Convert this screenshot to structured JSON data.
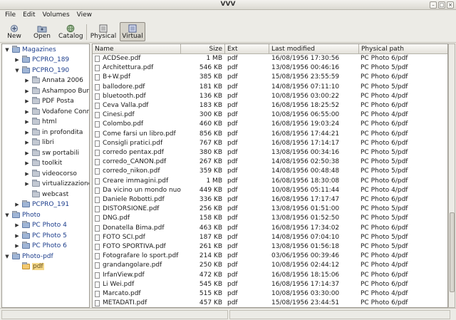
{
  "window": {
    "title": "VVV"
  },
  "menu": [
    "File",
    "Edit",
    "Volumes",
    "View"
  ],
  "toolbar": {
    "new": "New",
    "open": "Open",
    "catalog": "Catalog",
    "physical": "Physical",
    "virtual": "Virtual"
  },
  "tree": [
    {
      "label": "Magazines",
      "level": 0,
      "exp": "▼",
      "color": "blue"
    },
    {
      "label": "PCPRO_189",
      "level": 1,
      "exp": "▶",
      "color": "blue"
    },
    {
      "label": "PCPRO_190",
      "level": 1,
      "exp": "▼",
      "color": "blue"
    },
    {
      "label": "Annata 2006",
      "level": 2,
      "exp": "▶",
      "color": "gray"
    },
    {
      "label": "Ashampoo Burning",
      "level": 2,
      "exp": "▶",
      "color": "gray"
    },
    {
      "label": "PDF Posta",
      "level": 2,
      "exp": "▶",
      "color": "gray"
    },
    {
      "label": "Vodafone Connect",
      "level": 2,
      "exp": "▶",
      "color": "gray"
    },
    {
      "label": "html",
      "level": 2,
      "exp": "▶",
      "color": "gray"
    },
    {
      "label": "in profondita",
      "level": 2,
      "exp": "▶",
      "color": "gray"
    },
    {
      "label": "libri",
      "level": 2,
      "exp": "▶",
      "color": "gray"
    },
    {
      "label": "sw portabili",
      "level": 2,
      "exp": "▶",
      "color": "gray"
    },
    {
      "label": "toolkit",
      "level": 2,
      "exp": "▶",
      "color": "gray"
    },
    {
      "label": "videocorso",
      "level": 2,
      "exp": "▶",
      "color": "gray"
    },
    {
      "label": "virtualizzazione",
      "level": 2,
      "exp": "▶",
      "color": "gray"
    },
    {
      "label": "webcast",
      "level": 2,
      "exp": "",
      "color": "gray"
    },
    {
      "label": "PCPRO_191",
      "level": 1,
      "exp": "▶",
      "color": "blue"
    },
    {
      "label": "Photo",
      "level": 0,
      "exp": "▼",
      "color": "blue"
    },
    {
      "label": "PC Photo 4",
      "level": 1,
      "exp": "▶",
      "color": "blue"
    },
    {
      "label": "PC Photo 5",
      "level": 1,
      "exp": "▶",
      "color": "blue"
    },
    {
      "label": "PC Photo 6",
      "level": 1,
      "exp": "▶",
      "color": "blue"
    },
    {
      "label": "Photo-pdf",
      "level": 0,
      "exp": "▼",
      "color": "blue"
    },
    {
      "label": "pdf",
      "level": 1,
      "exp": "",
      "color": "selected"
    }
  ],
  "columns": {
    "name": "Name",
    "size": "Size",
    "ext": "Ext",
    "modified": "Last modified",
    "physical": "Physical path"
  },
  "files": [
    {
      "name": "ACDSee.pdf",
      "size": "1 MB",
      "ext": "pdf",
      "modified": "16/08/1956 17:30:56",
      "physical": "PC Photo 6/pdf"
    },
    {
      "name": "Architettura.pdf",
      "size": "546 KB",
      "ext": "pdf",
      "modified": "13/08/1956 00:46:16",
      "physical": "PC Photo 5/pdf"
    },
    {
      "name": "B+W.pdf",
      "size": "385 KB",
      "ext": "pdf",
      "modified": "15/08/1956 23:55:59",
      "physical": "PC Photo 6/pdf"
    },
    {
      "name": "ballodore.pdf",
      "size": "181 KB",
      "ext": "pdf",
      "modified": "14/08/1956 07:11:10",
      "physical": "PC Photo 5/pdf"
    },
    {
      "name": "bluetooth.pdf",
      "size": "136 KB",
      "ext": "pdf",
      "modified": "10/08/1956 03:00:22",
      "physical": "PC Photo 4/pdf"
    },
    {
      "name": "Ceva Valla.pdf",
      "size": "183 KB",
      "ext": "pdf",
      "modified": "16/08/1956 18:25:52",
      "physical": "PC Photo 6/pdf"
    },
    {
      "name": "Cinesi.pdf",
      "size": "300 KB",
      "ext": "pdf",
      "modified": "10/08/1956 06:55:00",
      "physical": "PC Photo 4/pdf"
    },
    {
      "name": "Colombo.pdf",
      "size": "460 KB",
      "ext": "pdf",
      "modified": "16/08/1956 19:03:24",
      "physical": "PC Photo 6/pdf"
    },
    {
      "name": "Come farsi un libro.pdf",
      "size": "856 KB",
      "ext": "pdf",
      "modified": "16/08/1956 17:44:21",
      "physical": "PC Photo 6/pdf"
    },
    {
      "name": "Consigli pratici.pdf",
      "size": "767 KB",
      "ext": "pdf",
      "modified": "16/08/1956 17:14:17",
      "physical": "PC Photo 6/pdf"
    },
    {
      "name": "corredo pentax.pdf",
      "size": "380 KB",
      "ext": "pdf",
      "modified": "13/08/1956 00:34:16",
      "physical": "PC Photo 5/pdf"
    },
    {
      "name": "corredo_CANON.pdf",
      "size": "267 KB",
      "ext": "pdf",
      "modified": "14/08/1956 02:50:38",
      "physical": "PC Photo 5/pdf"
    },
    {
      "name": "corredo_nikon.pdf",
      "size": "359 KB",
      "ext": "pdf",
      "modified": "14/08/1956 00:48:48",
      "physical": "PC Photo 5/pdf"
    },
    {
      "name": "Creare immagini.pdf",
      "size": "1 MB",
      "ext": "pdf",
      "modified": "16/08/1956 18:30:08",
      "physical": "PC Photo 6/pdf"
    },
    {
      "name": "Da vicino un mondo nuo...",
      "size": "449 KB",
      "ext": "pdf",
      "modified": "10/08/1956 05:11:44",
      "physical": "PC Photo 4/pdf"
    },
    {
      "name": "Daniele Robotti.pdf",
      "size": "336 KB",
      "ext": "pdf",
      "modified": "16/08/1956 17:17:47",
      "physical": "PC Photo 6/pdf"
    },
    {
      "name": "DISTORSIONE.pdf",
      "size": "256 KB",
      "ext": "pdf",
      "modified": "13/08/1956 01:51:00",
      "physical": "PC Photo 5/pdf"
    },
    {
      "name": "DNG.pdf",
      "size": "158 KB",
      "ext": "pdf",
      "modified": "13/08/1956 01:52:50",
      "physical": "PC Photo 5/pdf"
    },
    {
      "name": "Donatella Bima.pdf",
      "size": "463 KB",
      "ext": "pdf",
      "modified": "16/08/1956 17:34:02",
      "physical": "PC Photo 6/pdf"
    },
    {
      "name": "FOTO SCI.pdf",
      "size": "187 KB",
      "ext": "pdf",
      "modified": "14/08/1956 07:04:10",
      "physical": "PC Photo 5/pdf"
    },
    {
      "name": "FOTO SPORTIVA.pdf",
      "size": "261 KB",
      "ext": "pdf",
      "modified": "13/08/1956 01:56:18",
      "physical": "PC Photo 5/pdf"
    },
    {
      "name": "Fotografare lo sport.pdf",
      "size": "214 KB",
      "ext": "pdf",
      "modified": "03/06/1956 00:39:46",
      "physical": "PC Photo 4/pdf"
    },
    {
      "name": "grandangolare.pdf",
      "size": "250 KB",
      "ext": "pdf",
      "modified": "10/08/1956 02:44:12",
      "physical": "PC Photo 4/pdf"
    },
    {
      "name": "IrfanView.pdf",
      "size": "472 KB",
      "ext": "pdf",
      "modified": "16/08/1956 18:15:06",
      "physical": "PC Photo 6/pdf"
    },
    {
      "name": "Li Wei.pdf",
      "size": "545 KB",
      "ext": "pdf",
      "modified": "16/08/1956 17:14:37",
      "physical": "PC Photo 6/pdf"
    },
    {
      "name": "Marcato.pdf",
      "size": "515 KB",
      "ext": "pdf",
      "modified": "10/08/1956 03:30:00",
      "physical": "PC Photo 4/pdf"
    },
    {
      "name": "METADATI.pdf",
      "size": "457 KB",
      "ext": "pdf",
      "modified": "15/08/1956 23:44:51",
      "physical": "PC Photo 6/pdf"
    }
  ]
}
